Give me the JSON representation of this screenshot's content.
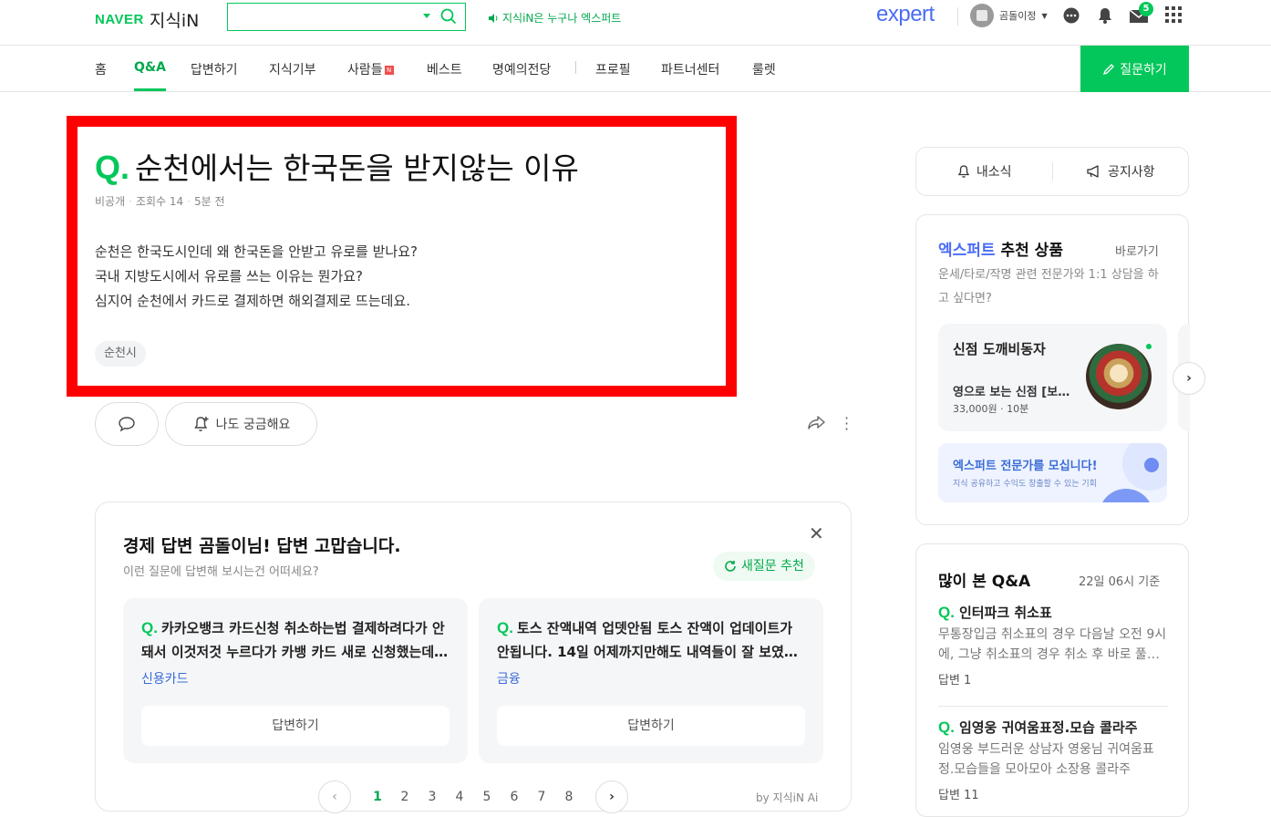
{
  "header": {
    "naver": "NAVER",
    "service": "지식iN",
    "slogan": "지식iN은 누구나 엑스퍼트",
    "expert_logo": "expert",
    "user_name": "곰돌이정",
    "mail_count": "5",
    "search_placeholder": ""
  },
  "nav": {
    "items": [
      "홈",
      "Q&A",
      "답변하기",
      "지식기부",
      "사람들",
      "베스트",
      "명예의전당",
      "프로필",
      "파트너센터",
      "룰렛"
    ],
    "new_badge": "N",
    "ask_button": "질문하기"
  },
  "question": {
    "q_mark": "Q.",
    "title": "순천에서는 한국돈을 받지않는 이유",
    "visibility": "비공개",
    "views": "조회수 14",
    "time": "5분 전",
    "body_lines": [
      "순천은 한국도시인데 왜 한국돈을 안받고 유로를 받나요?",
      "국내 지방도시에서 유로를 쓰는 이유는 뭔가요?",
      "심지어 순천에서 카드로 결제하면 해외결제로 뜨는데요."
    ],
    "tag": "순천시",
    "curious_label": "나도 궁금해요"
  },
  "recommend": {
    "title": "경제 답변 곰돌이님! 답변 고맙습니다.",
    "subtitle": "이런 질문에 답변해 보시는건 어떠세요?",
    "refresh_label": "새질문 추천",
    "cards": [
      {
        "q": "Q.",
        "text": "카카오뱅크 카드신청 취소하는법 결제하려다가 안돼서 이것저것 누르다가 카뱅 카드 새로 신청했는데 취소는 어떻게 하나요",
        "category": "신용카드",
        "answer": "답변하기"
      },
      {
        "q": "Q.",
        "text": "토스 잔액내역 업뎃안됨 토스 잔액이 업데이트가 안됩니다. 14일 어제까지만해도 내역들이 잘 보였는데 오늘부터",
        "category": "금융",
        "answer": "답변하기"
      }
    ],
    "pages": [
      "1",
      "2",
      "3",
      "4",
      "5",
      "6",
      "7",
      "8"
    ],
    "by_ai": "by 지식iN Ai"
  },
  "sidebar": {
    "my_news": "내소식",
    "notice": "공지사항",
    "expert": {
      "title_blue": "엑스퍼트",
      "title_rest": "추천 상품",
      "link": "바로가기",
      "desc": "운세/타로/작명 관련 전문가와 1:1 상담을 하고 싶다면?",
      "product_name": "신점 도깨비동자",
      "product_desc": "영으로 보는 신점 [보름달 ...",
      "product_price": "33,000원 · 10분",
      "banner_title": "엑스퍼트 전문가를 모십니다!",
      "banner_sub": "지식 공유하고 수익도 창출할 수 있는 기회"
    },
    "popular": {
      "title": "많이 본 Q&A",
      "time": "22일 06시 기준",
      "items": [
        {
          "q": "Q.",
          "title": "인터파크 취소표",
          "body": "무통장입금 취소표의 경우 다음날 오전 9시에, 그냥 취소표의 경우 취소 후 바로 풀립니다",
          "count": "답변 1"
        },
        {
          "q": "Q.",
          "title": "임영웅 귀여움표정.모습 콜라주",
          "body": "임영웅 부드러운 상남자 영웅님 귀여움표정.모습들을 모아모아 소장용 콜라주",
          "count": "답변 11"
        }
      ]
    }
  },
  "colors": {
    "brand": "#03c75a",
    "expert": "#4a6cf7",
    "highlight": "#ff0000"
  }
}
